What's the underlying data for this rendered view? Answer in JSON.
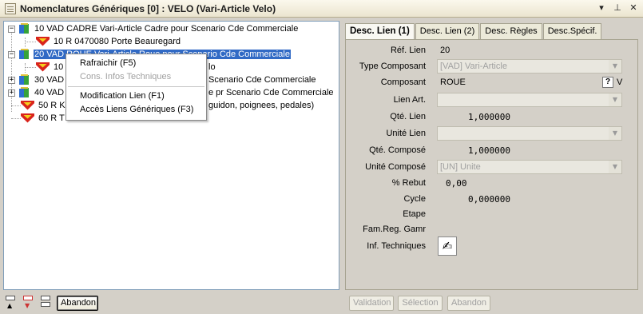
{
  "window": {
    "title": "Nomenclatures Génériques [0] : VELO (Vari-Article Velo)",
    "icon": "document-list-icon",
    "dropdown_glyph": "▾",
    "pin_glyph": "⊥",
    "close_glyph": "✕"
  },
  "tree": {
    "nodes": [
      {
        "label": "10 VAD CADRE Vari-Article Cadre pour Scenario Cde Commerciale",
        "icon": "cube-icon",
        "expander": "−"
      },
      {
        "label": "10 R 0470080 Porte Beauregard",
        "icon": "superman-icon"
      },
      {
        "label": "20 VAD ROUE Vari-Article Roue pour Scenario Cde Commerciale",
        "icon": "cube-icon",
        "expander": "−",
        "selected": true
      },
      {
        "label": "10 R ...........lo",
        "icon": "superman-icon"
      },
      {
        "label": "30 VAD ................Scenario Cde Commerciale",
        "icon": "cube-icon",
        "expander": "+"
      },
      {
        "label": "40 VAD ................e pr Scenario Cde Commerciale",
        "icon": "cube-icon",
        "expander": "+"
      },
      {
        "label": "50 R K.............guidon, poignees, pedales)",
        "icon": "superman-icon"
      },
      {
        "label": "60 R T.............Velo",
        "icon": "superman-icon"
      }
    ],
    "visible_fragments": {
      "row2": "20 VAD ROUE Vari-Article Roue pour Scenario Cde Commerciale",
      "row3_prefix": "10 R",
      "row3_suffix": "lo",
      "row4_prefix": "30 VAD",
      "row4_suffix": "Scenario Cde Commerciale",
      "row5_prefix": "40 VAD",
      "row5_suffix": "e pr Scenario Cde Commerciale",
      "row6_prefix": "50 R K",
      "row6_suffix": "guidon, poignees, pedales)",
      "row7_prefix": "60 R T",
      "row7_suffix": "Velo"
    }
  },
  "context_menu": {
    "items": [
      {
        "label": "Rafraichir (F5)",
        "enabled": true
      },
      {
        "label": "Cons. Infos Techniques",
        "enabled": false
      },
      {
        "label": "Modification Lien (F1)",
        "enabled": true
      },
      {
        "label": "Accès Liens Génériques (F3)",
        "enabled": true
      }
    ]
  },
  "left_toolbar": {
    "abandon_label": "Abandon"
  },
  "tabs": [
    {
      "label": "Desc. Lien (1)",
      "active": true
    },
    {
      "label": "Desc. Lien (2)",
      "active": false
    },
    {
      "label": "Desc. Règles",
      "active": false
    },
    {
      "label": "Desc.Spécif.",
      "active": false
    }
  ],
  "form": {
    "ref_lien": {
      "label": "Réf. Lien",
      "value": "20"
    },
    "type_composant": {
      "label": "Type Composant",
      "value": "[VAD] Vari-Article"
    },
    "composant": {
      "label": "Composant",
      "value": "ROUE",
      "help": "?",
      "suffix": "V"
    },
    "lien_art": {
      "label": "Lien Art.",
      "value": ""
    },
    "qte_lien": {
      "label": "Qté. Lien",
      "value": "1,000000"
    },
    "unite_lien": {
      "label": "Unité Lien",
      "value": ""
    },
    "qte_compose": {
      "label": "Qté. Composé",
      "value": "1,000000"
    },
    "unite_compose": {
      "label": "Unité Composé",
      "value": "[UN] Unite"
    },
    "pct_rebut": {
      "label": "% Rebut",
      "value": "0,00"
    },
    "cycle": {
      "label": "Cycle",
      "value": "0,000000"
    },
    "etape": {
      "label": "Etape",
      "value": ""
    },
    "fam_reg_gamr": {
      "label": "Fam.Reg. Gamr",
      "value": ""
    },
    "inf_techniques": {
      "label": "Inf. Techniques",
      "icon": "pen-edit-icon",
      "glyph": "✍"
    }
  },
  "bottom_buttons": {
    "validation": "Validation",
    "selection": "Sélection",
    "abandon": "Abandon"
  }
}
